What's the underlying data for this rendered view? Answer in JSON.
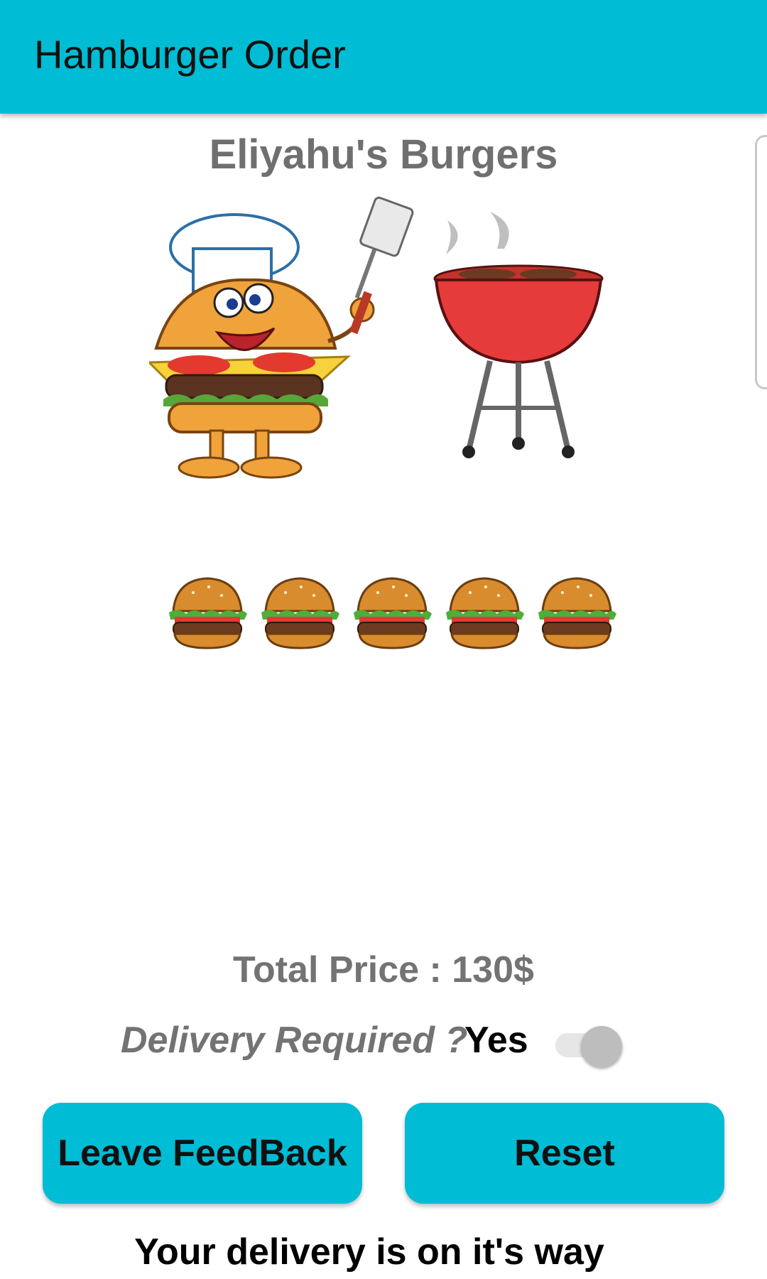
{
  "app_bar": {
    "title": "Hamburger Order",
    "color": "#00BCD4"
  },
  "restaurant": {
    "name": "Eliyahu's Burgers"
  },
  "hero": {
    "illustration": "chef-burger-and-grill-illustration"
  },
  "order": {
    "burger_count": 5,
    "burger_icon": "hamburger-icon"
  },
  "summary": {
    "total_price": "Total Price : 130$",
    "delivery_label": "Delivery Required ?",
    "delivery_value": "Yes",
    "delivery_toggle_on": true
  },
  "actions": {
    "feedback_label": "Leave FeedBack",
    "reset_label": "Reset"
  },
  "status": {
    "message": "Your delivery is on it's way"
  }
}
